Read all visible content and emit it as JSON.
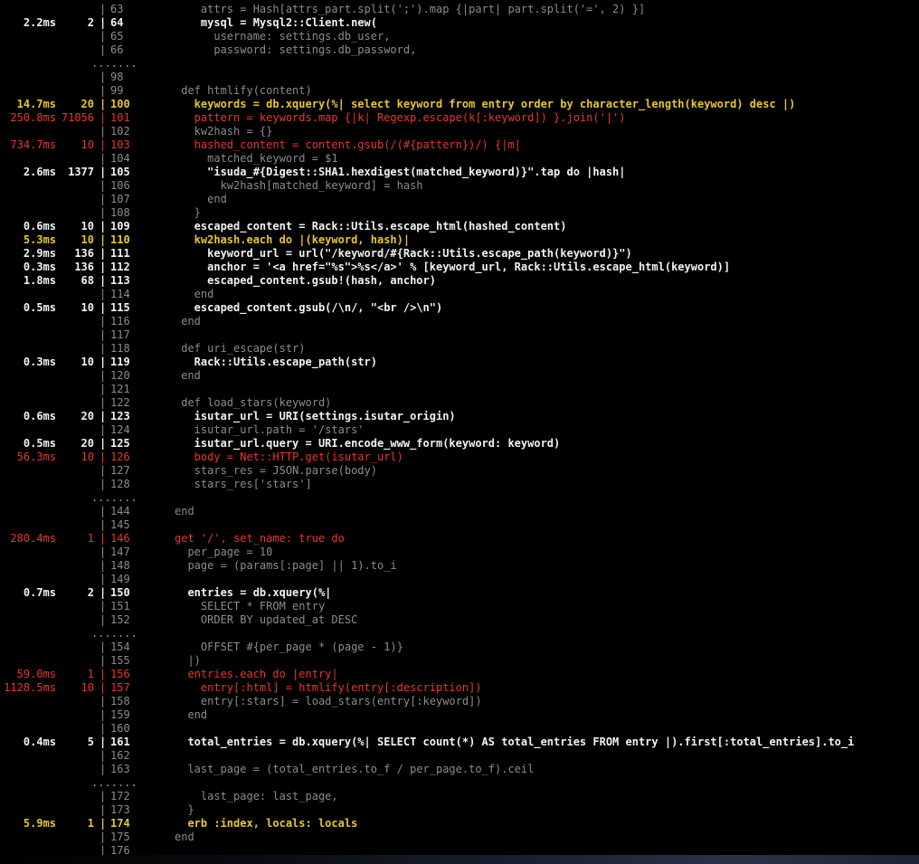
{
  "window": {
    "background": "#000000",
    "accent_colors": {
      "hot": "#e8372f",
      "warm": "#e8c62e",
      "normal": "#f2f2f2",
      "dim": "#8c8c8c"
    }
  },
  "lines": [
    {
      "time": "",
      "calls": "",
      "sep": "|",
      "ln": "63",
      "code": "    attrs = Hash[attrs_part.split(';').map {|part| part.split('=', 2) }]",
      "level": "gray"
    },
    {
      "time": "2.2ms",
      "calls": "2",
      "sep": "|",
      "ln": "64",
      "code": "    mysql = Mysql2::Client.new(",
      "level": "white"
    },
    {
      "time": "",
      "calls": "",
      "sep": "|",
      "ln": "65",
      "code": "      username: settings.db_user,",
      "level": "gray"
    },
    {
      "time": "",
      "calls": "",
      "sep": "|",
      "ln": "66",
      "code": "      password: settings.db_password,",
      "level": "gray"
    },
    {
      "ellipsis": "......."
    },
    {
      "time": "",
      "calls": "",
      "sep": "|",
      "ln": "98",
      "code": "",
      "level": "gray"
    },
    {
      "time": "",
      "calls": "",
      "sep": "|",
      "ln": "99",
      "code": " def htmlify(content)",
      "level": "gray"
    },
    {
      "time": "14.7ms",
      "calls": "20",
      "sep": "|",
      "ln": "100",
      "code": "   keywords = db.xquery(%| select keyword from entry order by character_length(keyword) desc |)",
      "level": "yellow"
    },
    {
      "time": "250.8ms",
      "calls": "71056",
      "sep": "|",
      "ln": "101",
      "code": "   pattern = keywords.map {|k| Regexp.escape(k[:keyword]) }.join('|')",
      "level": "red"
    },
    {
      "time": "",
      "calls": "",
      "sep": "|",
      "ln": "102",
      "code": "   kw2hash = {}",
      "level": "gray"
    },
    {
      "time": "734.7ms",
      "calls": "10",
      "sep": "|",
      "ln": "103",
      "code": "   hashed_content = content.gsub(/(#{pattern})/) {|m|",
      "level": "red"
    },
    {
      "time": "",
      "calls": "",
      "sep": "|",
      "ln": "104",
      "code": "     matched_keyword = $1",
      "level": "gray"
    },
    {
      "time": "2.6ms",
      "calls": "1377",
      "sep": "|",
      "ln": "105",
      "code": "     \"isuda_#{Digest::SHA1.hexdigest(matched_keyword)}\".tap do |hash|",
      "level": "white"
    },
    {
      "time": "",
      "calls": "",
      "sep": "|",
      "ln": "106",
      "code": "       kw2hash[matched_keyword] = hash",
      "level": "gray"
    },
    {
      "time": "",
      "calls": "",
      "sep": "|",
      "ln": "107",
      "code": "     end",
      "level": "gray"
    },
    {
      "time": "",
      "calls": "",
      "sep": "|",
      "ln": "108",
      "code": "   }",
      "level": "gray"
    },
    {
      "time": "0.6ms",
      "calls": "10",
      "sep": "|",
      "ln": "109",
      "code": "   escaped_content = Rack::Utils.escape_html(hashed_content)",
      "level": "white"
    },
    {
      "time": "5.3ms",
      "calls": "10",
      "sep": "|",
      "ln": "110",
      "code": "   kw2hash.each do |(keyword, hash)|",
      "level": "yellow"
    },
    {
      "time": "2.9ms",
      "calls": "136",
      "sep": "|",
      "ln": "111",
      "code": "     keyword_url = url(\"/keyword/#{Rack::Utils.escape_path(keyword)}\")",
      "level": "white"
    },
    {
      "time": "0.3ms",
      "calls": "136",
      "sep": "|",
      "ln": "112",
      "code": "     anchor = '<a href=\"%s\">%s</a>' % [keyword_url, Rack::Utils.escape_html(keyword)]",
      "level": "white"
    },
    {
      "time": "1.8ms",
      "calls": "68",
      "sep": "|",
      "ln": "113",
      "code": "     escaped_content.gsub!(hash, anchor)",
      "level": "white"
    },
    {
      "time": "",
      "calls": "",
      "sep": "|",
      "ln": "114",
      "code": "   end",
      "level": "gray"
    },
    {
      "time": "0.5ms",
      "calls": "10",
      "sep": "|",
      "ln": "115",
      "code": "   escaped_content.gsub(/\\n/, \"<br />\\n\")",
      "level": "white"
    },
    {
      "time": "",
      "calls": "",
      "sep": "|",
      "ln": "116",
      "code": " end",
      "level": "gray"
    },
    {
      "time": "",
      "calls": "",
      "sep": "|",
      "ln": "117",
      "code": "",
      "level": "gray"
    },
    {
      "time": "",
      "calls": "",
      "sep": "|",
      "ln": "118",
      "code": " def uri_escape(str)",
      "level": "gray"
    },
    {
      "time": "0.3ms",
      "calls": "10",
      "sep": "|",
      "ln": "119",
      "code": "   Rack::Utils.escape_path(str)",
      "level": "white"
    },
    {
      "time": "",
      "calls": "",
      "sep": "|",
      "ln": "120",
      "code": " end",
      "level": "gray"
    },
    {
      "time": "",
      "calls": "",
      "sep": "|",
      "ln": "121",
      "code": "",
      "level": "gray"
    },
    {
      "time": "",
      "calls": "",
      "sep": "|",
      "ln": "122",
      "code": " def load_stars(keyword)",
      "level": "gray"
    },
    {
      "time": "0.6ms",
      "calls": "20",
      "sep": "|",
      "ln": "123",
      "code": "   isutar_url = URI(settings.isutar_origin)",
      "level": "white"
    },
    {
      "time": "",
      "calls": "",
      "sep": "|",
      "ln": "124",
      "code": "   isutar_url.path = '/stars'",
      "level": "gray"
    },
    {
      "time": "0.5ms",
      "calls": "20",
      "sep": "|",
      "ln": "125",
      "code": "   isutar_url.query = URI.encode_www_form(keyword: keyword)",
      "level": "white"
    },
    {
      "time": "56.3ms",
      "calls": "10",
      "sep": "|",
      "ln": "126",
      "code": "   body = Net::HTTP.get(isutar_url)",
      "level": "red"
    },
    {
      "time": "",
      "calls": "",
      "sep": "|",
      "ln": "127",
      "code": "   stars_res = JSON.parse(body)",
      "level": "gray"
    },
    {
      "time": "",
      "calls": "",
      "sep": "|",
      "ln": "128",
      "code": "   stars_res['stars']",
      "level": "gray"
    },
    {
      "ellipsis": "......."
    },
    {
      "time": "",
      "calls": "",
      "sep": "|",
      "ln": "144",
      "code": "end",
      "level": "gray"
    },
    {
      "time": "",
      "calls": "",
      "sep": "|",
      "ln": "145",
      "code": "",
      "level": "gray"
    },
    {
      "time": "280.4ms",
      "calls": "1",
      "sep": "|",
      "ln": "146",
      "code": "get '/', set_name: true do",
      "level": "red"
    },
    {
      "time": "",
      "calls": "",
      "sep": "|",
      "ln": "147",
      "code": "  per_page = 10",
      "level": "gray"
    },
    {
      "time": "",
      "calls": "",
      "sep": "|",
      "ln": "148",
      "code": "  page = (params[:page] || 1).to_i",
      "level": "gray"
    },
    {
      "time": "",
      "calls": "",
      "sep": "|",
      "ln": "149",
      "code": "",
      "level": "gray"
    },
    {
      "time": "0.7ms",
      "calls": "2",
      "sep": "|",
      "ln": "150",
      "code": "  entries = db.xquery(%|",
      "level": "white"
    },
    {
      "time": "",
      "calls": "",
      "sep": "|",
      "ln": "151",
      "code": "    SELECT * FROM entry",
      "level": "gray"
    },
    {
      "time": "",
      "calls": "",
      "sep": "|",
      "ln": "152",
      "code": "    ORDER BY updated_at DESC",
      "level": "gray"
    },
    {
      "ellipsis": "......."
    },
    {
      "time": "",
      "calls": "",
      "sep": "|",
      "ln": "154",
      "code": "    OFFSET #{per_page * (page - 1)}",
      "level": "gray"
    },
    {
      "time": "",
      "calls": "",
      "sep": "|",
      "ln": "155",
      "code": "  |)",
      "level": "gray"
    },
    {
      "time": "59.0ms",
      "calls": "1",
      "sep": "|",
      "ln": "156",
      "code": "  entries.each do |entry|",
      "level": "red"
    },
    {
      "time": "1128.5ms",
      "calls": "10",
      "sep": "|",
      "ln": "157",
      "code": "    entry[:html] = htmlify(entry[:description])",
      "level": "red"
    },
    {
      "time": "",
      "calls": "",
      "sep": "|",
      "ln": "158",
      "code": "    entry[:stars] = load_stars(entry[:keyword])",
      "level": "gray"
    },
    {
      "time": "",
      "calls": "",
      "sep": "|",
      "ln": "159",
      "code": "  end",
      "level": "gray"
    },
    {
      "time": "",
      "calls": "",
      "sep": "|",
      "ln": "160",
      "code": "",
      "level": "gray"
    },
    {
      "time": "0.4ms",
      "calls": "5",
      "sep": "|",
      "ln": "161",
      "code": "  total_entries = db.xquery(%| SELECT count(*) AS total_entries FROM entry |).first[:total_entries].to_i",
      "level": "white"
    },
    {
      "time": "",
      "calls": "",
      "sep": "|",
      "ln": "162",
      "code": "",
      "level": "gray"
    },
    {
      "time": "",
      "calls": "",
      "sep": "|",
      "ln": "163",
      "code": "  last_page = (total_entries.to_f / per_page.to_f).ceil",
      "level": "gray"
    },
    {
      "ellipsis": "......."
    },
    {
      "time": "",
      "calls": "",
      "sep": "|",
      "ln": "172",
      "code": "    last_page: last_page,",
      "level": "gray"
    },
    {
      "time": "",
      "calls": "",
      "sep": "|",
      "ln": "173",
      "code": "  }",
      "level": "gray"
    },
    {
      "time": "5.9ms",
      "calls": "1",
      "sep": "|",
      "ln": "174",
      "code": "  erb :index, locals: locals",
      "level": "yellow"
    },
    {
      "time": "",
      "calls": "",
      "sep": "|",
      "ln": "175",
      "code": "end",
      "level": "gray"
    },
    {
      "time": "",
      "calls": "",
      "sep": "|",
      "ln": "176",
      "code": "",
      "level": "gray"
    }
  ]
}
